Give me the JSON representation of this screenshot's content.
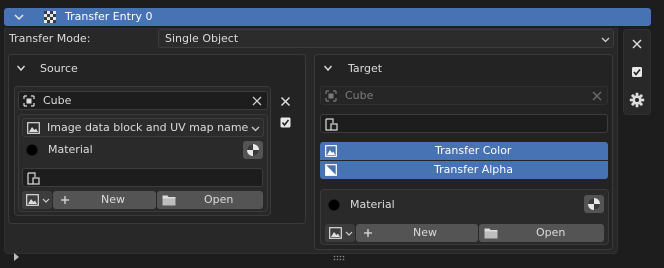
{
  "header": {
    "title": "Transfer Entry 0"
  },
  "transfer_mode": {
    "label": "Transfer Mode:",
    "value": "Single Object"
  },
  "source": {
    "title": "Source",
    "object": "Cube",
    "data_type": "Image data block and UV map name",
    "material_label": "Material",
    "new_label": "New",
    "open_label": "Open"
  },
  "target": {
    "title": "Target",
    "object_placeholder": "Cube",
    "transfer_color": "Transfer Color",
    "transfer_alpha": "Transfer Alpha",
    "material_label": "Material",
    "new_label": "New",
    "open_label": "Open"
  },
  "colors": {
    "accent": "#4772b3",
    "background": "#1d1d1d",
    "panel": "#282828",
    "button": "#545454"
  }
}
